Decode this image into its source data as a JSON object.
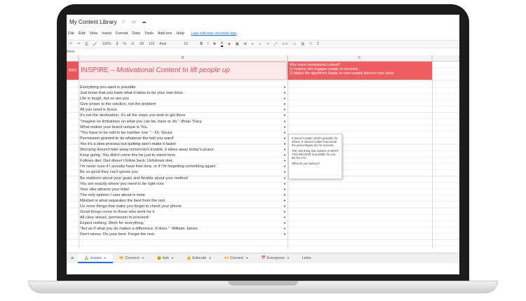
{
  "doc": {
    "title": "My Content Library",
    "title_icons": "☆ ▭ ☁"
  },
  "menu": {
    "items": [
      "File",
      "Edit",
      "View",
      "Insert",
      "Format",
      "Data",
      "Tools",
      "Add-ons",
      "Help"
    ],
    "last_edit": "Last edit was seconds ago"
  },
  "toolbar": {
    "zoom": "100%",
    "currency": "$",
    "percent": "%",
    "decimal_less": ".0",
    "decimal_more": ".00",
    "number_format": "123",
    "font": "Arial",
    "font_size": "10",
    "bold": "B",
    "italic": "I",
    "strike": "S",
    "text_color": "A",
    "sigma": "Σ"
  },
  "formula_bar": {
    "content": "itions"
  },
  "columns": {
    "b": "B",
    "c": "C"
  },
  "header": {
    "cell_a": "IRED",
    "title_prefix": "INSPIRE",
    "title_rest": " – Motivational Content to lift people up",
    "cell_c": [
      "Why share motivational content?",
      "1) Inspires and engages people to comment",
      "2) Makes the algorithms happy so more people discover your posts"
    ]
  },
  "quotes": [
    "Everything you want is possible",
    "Just know that you have what it takes to be your own boss",
    "Life is tough, but so are you",
    "Give power to the solution, not the problem",
    "All you need is focus",
    "It's not the destination, it's all the steps you took to get there",
    "\"Imagine no limitations on what you can be, have or do.\" -Brian Tracy",
    "What makes your brand unique is You",
    "\"You have to be odd to be number one.\"  – Dr. Seuss",
    "Permission granted to do whatever the hell you want!",
    "Yes it's a slow process but quitting won't make it faster",
    "Worrying doesn't take away tomorrow's trouble. It takes away today's peace.",
    "Keep going. You didn't come this far just to stand here.",
    "Follows diet. Diet doesn't follow back. Unfollows diet.",
    "I'm never sure if I actually have free time, or if I'm forgetting something again!",
    "Be so good they can't ignore you",
    "Be stubborn about your goals and flexible about your method",
    "You are exactly where you need to be right now",
    "Your vibe attracts your tribe!",
    "The only opinion I care about is mine",
    "Mindset is what separates the best from the rest",
    "Do more things that make you forget to check your phone",
    "Good things come to those who work for it",
    "All clear ahead, permission to proceed!",
    "Expect nothing. Work for everything.",
    "\"Act as if what you do makes a difference. It does.\"  -William James",
    "Don't stress. Do your best. Forget the rest."
  ],
  "note": {
    "p1": "It doesn't matter what's possible for others. It doesn't matter how small the percentages are for success.",
    "p2": "The only thing that matters is WHAT YOU BELIEVE is possible for you. Be the 1%!",
    "p3": "What do you believe?"
  },
  "tabs": [
    {
      "label": "🙏 Inspire"
    },
    {
      "label": "🤝 Connect"
    },
    {
      "label": "😀 Ask"
    },
    {
      "label": "👍 Educate"
    },
    {
      "label": "👐 Convert"
    },
    {
      "label": "📅 Evergreen"
    },
    {
      "label": "Links"
    }
  ],
  "colors": {
    "accent_red": "#ef5c61",
    "title_red": "#e05050",
    "active_tab_blue": "#1a73e8"
  }
}
